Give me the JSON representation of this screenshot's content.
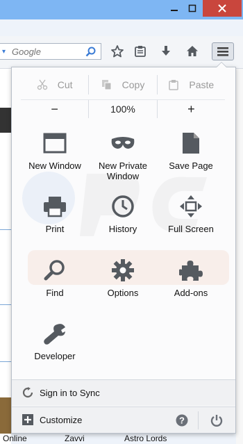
{
  "search": {
    "placeholder": "Google"
  },
  "edit": {
    "cut": "Cut",
    "copy": "Copy",
    "paste": "Paste"
  },
  "zoom": {
    "minus": "−",
    "level": "100%",
    "plus": "+"
  },
  "menu_items": [
    {
      "label": "New Window"
    },
    {
      "label": "New Private Window"
    },
    {
      "label": "Save Page"
    },
    {
      "label": "Print"
    },
    {
      "label": "History"
    },
    {
      "label": "Full Screen"
    },
    {
      "label": "Find"
    },
    {
      "label": "Options"
    },
    {
      "label": "Add-ons"
    },
    {
      "label": "Developer"
    }
  ],
  "footer": {
    "sync": "Sign in to Sync",
    "customize": "Customize"
  },
  "bookmarks": [
    "Online",
    "Zavvi",
    "Astro Lords"
  ],
  "colors": {
    "accent": "#3a7bd5",
    "close": "#c9463d",
    "icon": "#555a60"
  }
}
